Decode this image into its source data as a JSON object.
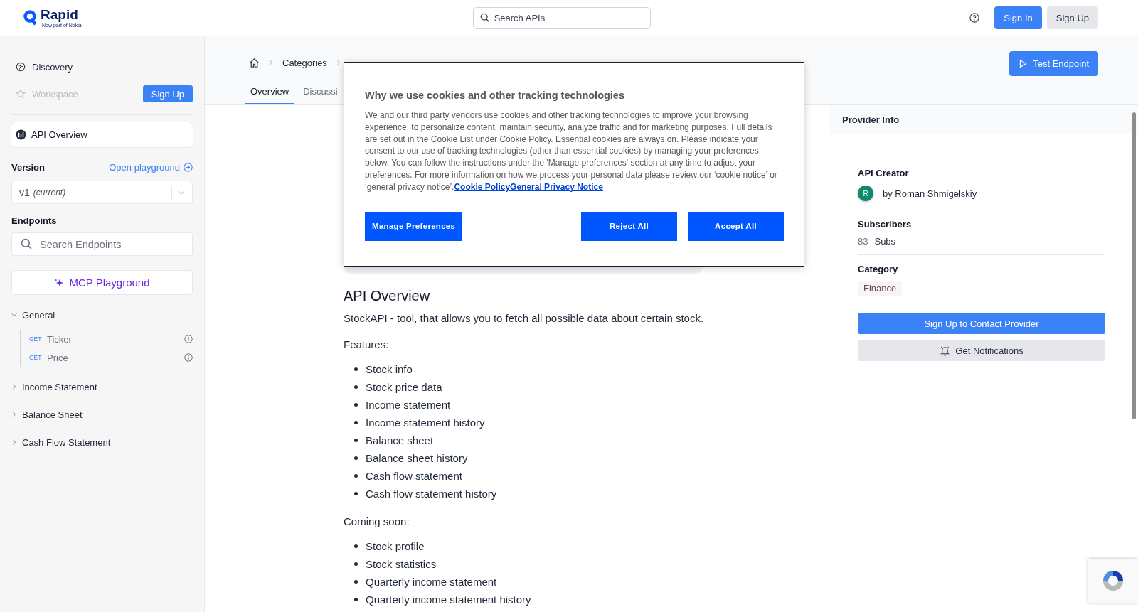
{
  "header": {
    "logo": "Rapid",
    "logo_tagline": "Now part of Nokia",
    "search": {
      "placeholder": "Search APIs"
    },
    "buttons": [
      {
        "label": "Sign In",
        "kind": "primary"
      },
      {
        "label": "Sign Up",
        "kind": "secondary"
      }
    ]
  },
  "sidebar": {
    "nav": [
      {
        "label": "Discovery",
        "disabled": false
      },
      {
        "label": "Workspace",
        "disabled": true
      }
    ],
    "signup_button": "Sign Up",
    "overview": {
      "label": "API Overview",
      "selected": true
    },
    "version": {
      "label": "Version",
      "link": "Open playground",
      "value": "v1",
      "value_note": "(current)"
    },
    "endpoints": {
      "label": "Endpoints",
      "search_placeholder": "Search Endpoints",
      "mcp_button": "MCP Playground",
      "groups": [
        {
          "label": "General",
          "expanded": true,
          "children": [
            {
              "method": "GET",
              "label": "Ticker"
            },
            {
              "method": "GET",
              "label": "Price"
            }
          ]
        },
        {
          "label": "Income Statement",
          "expanded": false
        },
        {
          "label": "Balance Sheet",
          "expanded": false
        },
        {
          "label": "Cash Flow Statement",
          "expanded": false
        }
      ]
    }
  },
  "breadcrumb": [
    "Categories"
  ],
  "tabs": [
    {
      "label": "Overview",
      "selected": true
    },
    {
      "label": "Discussi",
      "selected": false
    }
  ],
  "test_button": "Test Endpoint",
  "overview": {
    "title": "API Overview",
    "intro": "StockAPI - tool, that allows you to fetch all possible data about certain stock.",
    "sections": [
      {
        "heading": "Features:",
        "items": [
          "Stock info",
          "Stock price data",
          "Income statement",
          "Income statement history",
          "Balance sheet",
          "Balance sheet history",
          "Cash flow statement",
          "Cash flow statement history"
        ]
      },
      {
        "heading": "Coming soon:",
        "items": [
          "Stock profile",
          "Stock statistics",
          "Quarterly income statement",
          "Quarterly income statement history"
        ]
      }
    ]
  },
  "provider": {
    "title": "Provider Info",
    "creator_label": "API Creator",
    "creator_initial": "R",
    "creator_name": "by Roman Shmigelskiy",
    "subscribers_label": "Subscribers",
    "subscribers_count": "83",
    "subscribers_unit": "Subs",
    "category_label": "Category",
    "category": "Finance",
    "contact_button": "Sign Up to Contact Provider",
    "notify_button": "Get Notifications"
  },
  "cookie_dialog": {
    "title": "Why we use cookies and other tracking technologies",
    "body": "We and our third party vendors use cookies and other tracking technologies to improve your browsing experience, to personalize content, maintain security, analyze traffic and for marketing purposes. Full details are set out in the Cookie List under Cookie Policy. Essential cookies are always on. Please indicate your consent to our use of tracking technologies (other than essential cookies) by managing your preferences below. You can follow the instructions under the 'Manage preferences' section at any time to adjust your preferences. For more information on how we process your personal data please review our ‘cookie notice’ or ‘general privacy notice’.",
    "link": "Cookie PolicyGeneral Privacy Notice",
    "buttons": [
      "Manage Preferences",
      "Reject All",
      "Accept All"
    ]
  }
}
